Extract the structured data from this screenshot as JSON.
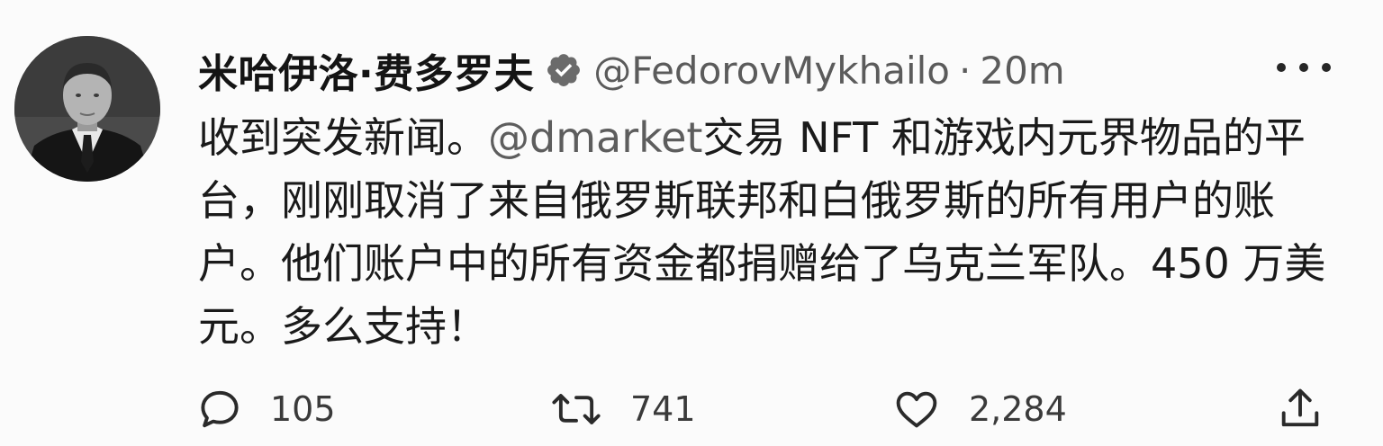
{
  "tweet": {
    "author": {
      "display_name": "米哈伊洛·费多罗夫",
      "handle": "@FedorovMykhailo",
      "separator": "·",
      "time": "20m",
      "verified": true
    },
    "icons": {
      "avatar": "profile-photo",
      "verified": "verified-badge-icon",
      "more": "more-options-icon"
    },
    "body": {
      "part1": "收到突发新闻。",
      "mention": "@dmarket",
      "part2": "交易 NFT 和游戏内元界物品的平台，刚刚取消了来自俄罗斯联邦和白俄罗斯的所有用户的账户。他们账户中的所有资金都捐赠给了乌克兰军队。450 万美元。多么支持！"
    },
    "actions": {
      "reply": {
        "icon": "reply-icon",
        "count": "105"
      },
      "retweet": {
        "icon": "retweet-icon",
        "count": "741"
      },
      "like": {
        "icon": "like-icon",
        "count": "2,284"
      },
      "share": {
        "icon": "share-icon"
      }
    }
  }
}
